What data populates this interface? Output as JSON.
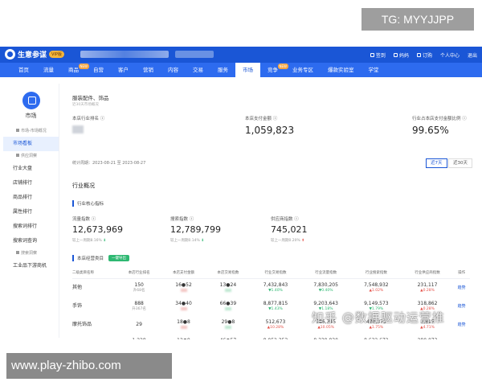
{
  "watermarks": {
    "tg": "TG: MYYJJPP",
    "site": "www.play-zhibo.com",
    "zhihu": "知乎 @数据驱动运营推"
  },
  "topbar": {
    "app_name": "生意参谋",
    "vip": "VIP版",
    "right_items": [
      "签到",
      "妈妈",
      "订购",
      "个人中心",
      "退出"
    ]
  },
  "nav": {
    "items": [
      {
        "label": "首页"
      },
      {
        "label": "流量"
      },
      {
        "label": "商品",
        "badge": "NEW"
      },
      {
        "label": "自营"
      },
      {
        "label": "客户"
      },
      {
        "label": "营销"
      },
      {
        "label": "内容"
      },
      {
        "label": "交易"
      },
      {
        "label": "服务"
      },
      {
        "label": "市场",
        "active": true
      },
      {
        "label": "竞争",
        "badge": "NEW"
      },
      {
        "label": "业务专区"
      },
      {
        "label": "爆款实验室"
      },
      {
        "label": "学堂"
      }
    ]
  },
  "sidebar": {
    "title": "市场",
    "items": [
      {
        "label": "市场-市场概况",
        "type": "sub"
      },
      {
        "label": "市场看板",
        "type": "item",
        "active": true
      },
      {
        "label": "供应洞察",
        "type": "sub"
      },
      {
        "label": "行业大盘",
        "type": "item"
      },
      {
        "label": "店铺排行",
        "type": "item"
      },
      {
        "label": "商品排行",
        "type": "item"
      },
      {
        "label": "属性排行",
        "type": "item"
      },
      {
        "label": "搜索词排行",
        "type": "item"
      },
      {
        "label": "搜索词查询",
        "type": "item"
      },
      {
        "label": "搜索洞察",
        "type": "sub"
      },
      {
        "label": "工业品下游商机",
        "type": "item"
      }
    ]
  },
  "overview": {
    "category": "服装配件、饰品",
    "category_sub": "近30天市场概况",
    "metrics": [
      {
        "label": "本店行业排名 ⓘ",
        "value": ""
      },
      {
        "label": "本店支付金额 ⓘ",
        "value": "1,059,823"
      },
      {
        "label": "行业占本店支付金额比例 ⓘ",
        "value": "99.65%"
      }
    ]
  },
  "date_bar": {
    "text": "统计周期：2023-08-21 至 2023-08-27",
    "btn_7": "近7天",
    "btn_30": "近30天"
  },
  "industry": {
    "title": "行业概况",
    "core_title": "行业核心指标",
    "kpis": [
      {
        "label": "流量指数 ⓘ",
        "value": "12,673,969",
        "delta": "较上一周期8.16%",
        "dir": "down"
      },
      {
        "label": "搜索指数 ⓘ",
        "value": "12,789,799",
        "delta": "较上一周期0.14%",
        "dir": "down"
      },
      {
        "label": "供应商指数 ⓘ",
        "value": "745,021",
        "delta": "较上一周期0.20%",
        "dir": "up"
      }
    ],
    "table_title": "本店经营类目",
    "table_badge": "一键导出",
    "columns": [
      "二级类目名称",
      "本店行业排名",
      "本店支付金额",
      "本店交易指数",
      "行业交易指数",
      "行业流量指数",
      "行业搜索指数",
      "行业供应商指数",
      "操作"
    ],
    "rows": [
      {
        "name": "其他",
        "rank": "150",
        "rank_sub": "升68名",
        "pay": "16●52",
        "trade": "13●24",
        "ind_trade": "7,432,843",
        "ind_trade_pct": "▼1.40%",
        "ind_trade_dir": "down",
        "ind_flow": "7,830,205",
        "ind_flow_pct": "▼0.40%",
        "ind_flow_dir": "down",
        "ind_search": "7,548,932",
        "ind_search_pct": "▲1.02%",
        "ind_search_dir": "up",
        "ind_supply": "231,117",
        "ind_supply_pct": "▲0.28%",
        "ind_supply_dir": "up",
        "op": "趋势"
      },
      {
        "name": "手饰",
        "rank": "888",
        "rank_sub": "升367名",
        "pay": "34●40",
        "trade": "66●39",
        "ind_trade": "8,877,815",
        "ind_trade_pct": "▼1.43%",
        "ind_trade_dir": "down",
        "ind_flow": "9,203,643",
        "ind_flow_pct": "▼1.18%",
        "ind_flow_dir": "down",
        "ind_search": "9,149,573",
        "ind_search_pct": "▼1.79%",
        "ind_search_dir": "down",
        "ind_supply": "318,862",
        "ind_supply_pct": "▲0.28%",
        "ind_supply_dir": "up",
        "op": "趋势"
      },
      {
        "name": "摩托饰品",
        "rank": "29",
        "rank_sub": "",
        "pay": "18●8",
        "trade": "29●8",
        "ind_trade": "512,673",
        "ind_trade_pct": "▲10.28%",
        "ind_trade_dir": "up",
        "ind_flow": "586,345",
        "ind_flow_pct": "▲10.05%",
        "ind_flow_dir": "up",
        "ind_search": "489,371",
        "ind_search_pct": "▲1.75%",
        "ind_search_dir": "up",
        "ind_supply": "3,815",
        "ind_supply_pct": "▲4.71%",
        "ind_supply_dir": "up",
        "op": "趋势"
      },
      {
        "name": "项饰",
        "rank": "1,228",
        "rank_sub": "升115名",
        "pay": "12●9",
        "trade": "46●57",
        "ind_trade": "8,052,353",
        "ind_trade_pct": "▼2.05%",
        "ind_trade_dir": "down",
        "ind_flow": "8,339,830",
        "ind_flow_pct": "▼2.42%",
        "ind_flow_dir": "down",
        "ind_search": "8,632,672",
        "ind_search_pct": "▼0.95%",
        "ind_search_dir": "down",
        "ind_supply": "280,073",
        "ind_supply_pct": "▼0.07%",
        "ind_supply_dir": "down",
        "op": "趋势"
      }
    ]
  },
  "colors": {
    "primary": "#1a56d6",
    "nav": "#2d6bef",
    "up": "#e5534b",
    "down": "#2eb872"
  }
}
